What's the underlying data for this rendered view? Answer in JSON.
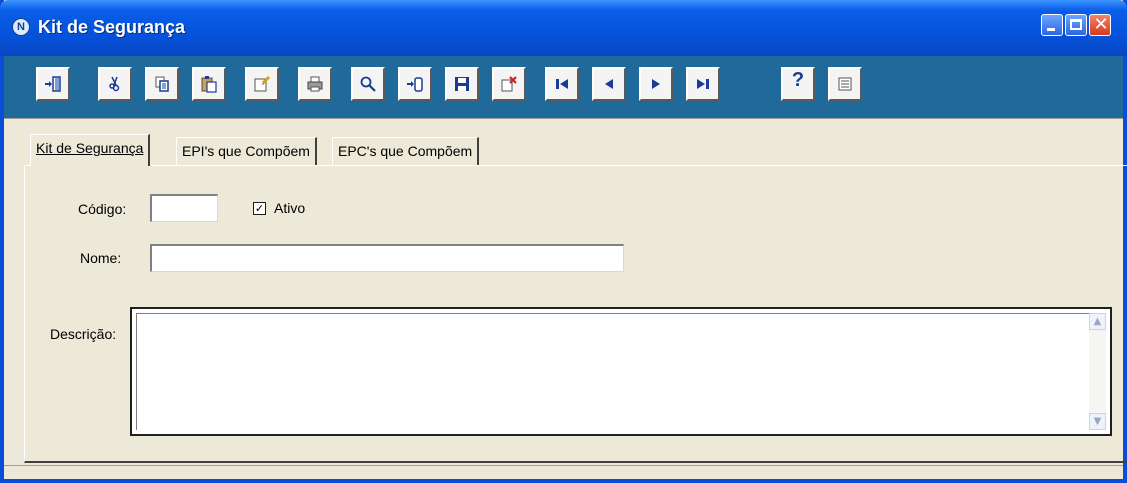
{
  "window": {
    "title": "Kit de Segurança",
    "icon_letter": "N",
    "controls": [
      "minimize-icon",
      "maximize-icon",
      "close-icon"
    ],
    "close_glyph": "✕"
  },
  "toolbar": {
    "buttons": [
      {
        "id": "exit",
        "icon": "exit-door-icon"
      },
      {
        "id": "cut",
        "icon": "scissors-icon"
      },
      {
        "id": "copy",
        "icon": "copy-icon"
      },
      {
        "id": "paste",
        "icon": "paste-icon"
      },
      {
        "id": "edit",
        "icon": "edit-note-icon"
      },
      {
        "id": "print",
        "icon": "printer-icon"
      },
      {
        "id": "search",
        "icon": "magnifier-icon"
      },
      {
        "id": "insert",
        "icon": "insert-record-icon"
      },
      {
        "id": "save",
        "icon": "floppy-disk-icon"
      },
      {
        "id": "delete",
        "icon": "delete-record-icon"
      },
      {
        "id": "first",
        "icon": "first-record-icon"
      },
      {
        "id": "prev",
        "icon": "previous-record-icon"
      },
      {
        "id": "next",
        "icon": "next-record-icon"
      },
      {
        "id": "last",
        "icon": "last-record-icon"
      },
      {
        "id": "help",
        "icon": "help-icon",
        "label": "?"
      },
      {
        "id": "list",
        "icon": "list-view-icon"
      }
    ]
  },
  "tabs": [
    {
      "label": "Kit de Segurança",
      "active": true
    },
    {
      "label": "EPI's que Compõem",
      "active": false
    },
    {
      "label": "EPC's que Compõem",
      "active": false
    }
  ],
  "form": {
    "codigo_label": "Código:",
    "codigo_value": "",
    "ativo_label": "Ativo",
    "ativo_checked": true,
    "ativo_check_glyph": "✓",
    "nome_label": "Nome:",
    "nome_value": "",
    "descricao_label": "Descrição:",
    "descricao_value": ""
  },
  "scrollbar": {
    "up_glyph": "▲",
    "down_glyph": "▼"
  },
  "colors": {
    "titlebar": "#0553dc",
    "toolbar": "#1f6a9a",
    "navy_icon": "#1a3c94",
    "panel": "#ece9d8"
  }
}
